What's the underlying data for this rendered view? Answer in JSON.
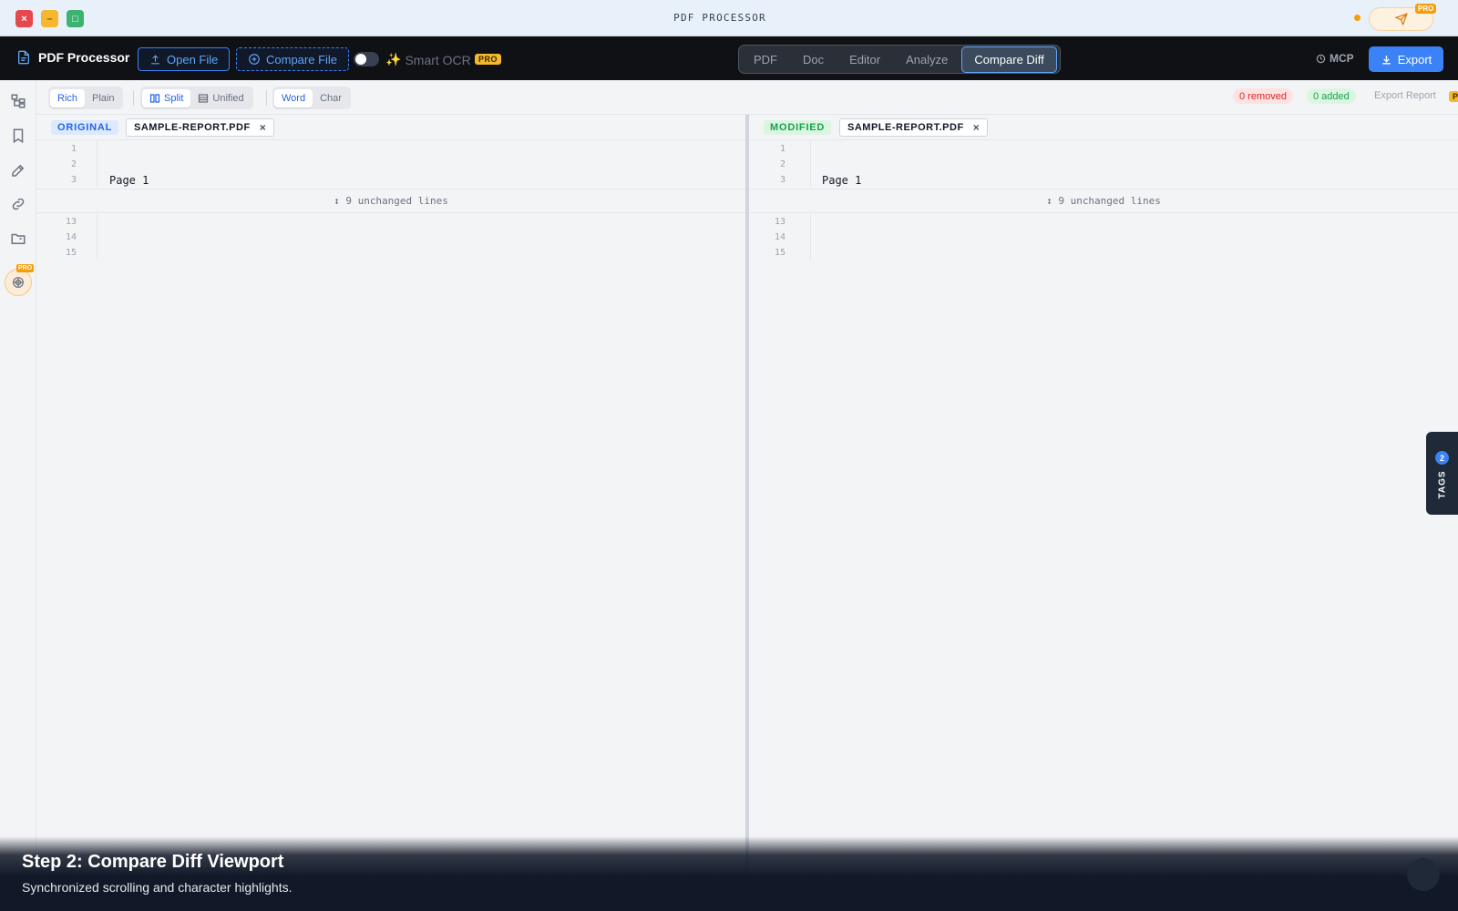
{
  "window": {
    "title": "PDF PROCESSOR",
    "pro_label": "PRO"
  },
  "toolbar": {
    "brand": "PDF Processor",
    "open_file": "Open File",
    "compare_file": "Compare File",
    "smart_ocr": "Smart OCR",
    "smart_ocr_enabled": false,
    "pro_label": "PRO",
    "mode_tabs": [
      {
        "label": "PDF",
        "active": false
      },
      {
        "label": "Doc",
        "active": false
      },
      {
        "label": "Editor",
        "active": false
      },
      {
        "label": "Analyze",
        "active": false
      },
      {
        "label": "Compare Diff",
        "active": true
      }
    ],
    "mcp": "MCP",
    "export": "Export"
  },
  "sidebar": {
    "items": [
      {
        "icon": "structure-icon"
      },
      {
        "icon": "bookmark-icon"
      },
      {
        "icon": "edit-icon"
      },
      {
        "icon": "link-icon"
      },
      {
        "icon": "folder-icon"
      }
    ],
    "pro_label": "PRO"
  },
  "options": {
    "render": {
      "rich": "Rich",
      "plain": "Plain",
      "selected": "Rich"
    },
    "layout": {
      "split": "Split",
      "unified": "Unified",
      "selected": "Split"
    },
    "granularity": {
      "word": "Word",
      "char": "Char",
      "selected": "Word"
    },
    "removed": "0 removed",
    "added": "0 added",
    "export_report": "Export Report",
    "pro_label": "PRO"
  },
  "original": {
    "label": "ORIGINAL",
    "file": "SAMPLE-REPORT.PDF",
    "lines_top": [
      {
        "n": "1",
        "text": ""
      },
      {
        "n": "2",
        "text": ""
      },
      {
        "n": "3",
        "text": "Page 1"
      }
    ],
    "collapsed": "↕ 9 unchanged lines",
    "lines_bottom": [
      {
        "n": "13",
        "text": ""
      },
      {
        "n": "14",
        "text": ""
      },
      {
        "n": "15",
        "text": ""
      }
    ]
  },
  "modified": {
    "label": "MODIFIED",
    "file": "SAMPLE-REPORT.PDF",
    "lines_top": [
      {
        "n": "1",
        "text": ""
      },
      {
        "n": "2",
        "text": ""
      },
      {
        "n": "3",
        "text": "Page 1"
      }
    ],
    "collapsed": "↕ 9 unchanged lines",
    "lines_bottom": [
      {
        "n": "13",
        "text": ""
      },
      {
        "n": "14",
        "text": ""
      },
      {
        "n": "15",
        "text": ""
      }
    ]
  },
  "tags": {
    "label": "TAGS",
    "count": "2"
  },
  "caption": {
    "title": "Step 2: Compare Diff Viewport",
    "subtitle": "Synchronized scrolling and character highlights."
  },
  "colors": {
    "accent": "#3b82f6",
    "toolbar_bg": "#0f1115",
    "pro_badge": "#f5b82e",
    "removed": "#dc2626",
    "added": "#16a34a"
  }
}
